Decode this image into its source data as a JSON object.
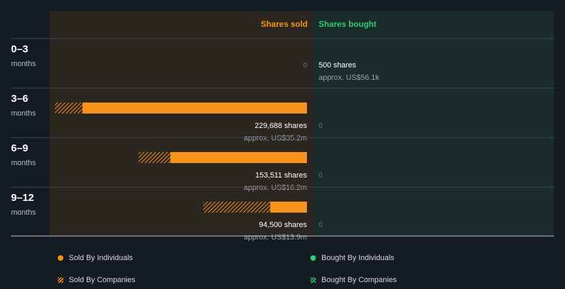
{
  "chart_data": {
    "type": "bar",
    "headers": {
      "sold": "Shares sold",
      "bought": "Shares bought"
    },
    "unit_label": "months",
    "categories": [
      "0–3",
      "3–6",
      "6–9",
      "9–12"
    ],
    "sold_total_shares": [
      0,
      229688,
      153511,
      94500
    ],
    "sold_by_companies_shares": [
      0,
      25000,
      29000,
      61000
    ],
    "sold_labels": [
      "0",
      "229,688 shares",
      "153,511 shares",
      "94,500 shares"
    ],
    "sold_values": [
      "",
      "approx. US$35.2m",
      "approx. US$16.2m",
      "approx. US$13.9m"
    ],
    "bought_total_shares": [
      500,
      0,
      0,
      0
    ],
    "bought_labels": [
      "500 shares",
      "0",
      "0",
      "0"
    ],
    "bought_values": [
      "approx. US$56.1k",
      "",
      "",
      ""
    ],
    "xlim": [
      0,
      229688
    ],
    "legend": {
      "sold_individuals": "Sold By Individuals",
      "sold_companies": "Sold By Companies",
      "bought_individuals": "Bought By Individuals",
      "bought_companies": "Bought By Companies"
    },
    "colors": {
      "background": "#151b24",
      "sold_panel": "#2c2620",
      "bought_panel": "#1b2c2c",
      "sold": "#f7931a",
      "bought": "#2ecc71",
      "separator": "#3a4550"
    }
  }
}
